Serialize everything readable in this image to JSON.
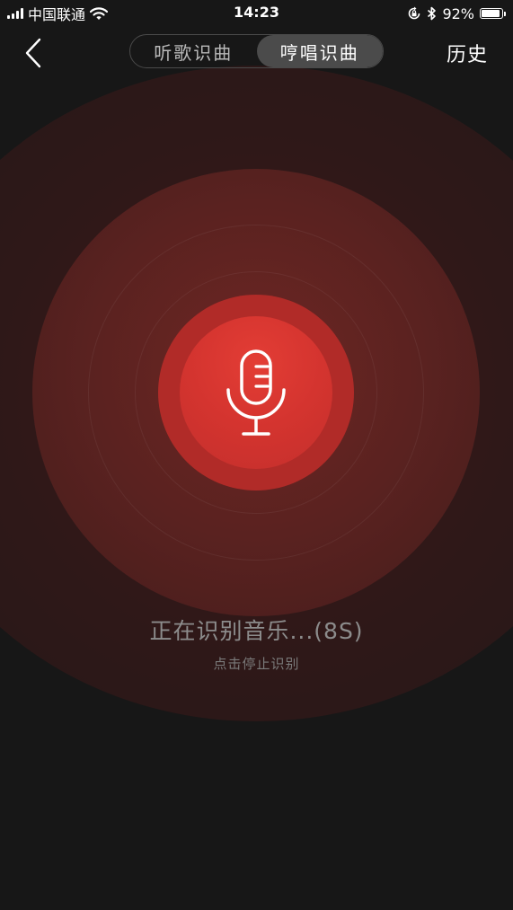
{
  "status_bar": {
    "carrier": "中国联通",
    "time": "14:23",
    "battery_percent": "92%",
    "battery_level": 0.92,
    "icons": [
      "signal-icon",
      "wifi-icon",
      "rotation-lock-icon",
      "bluetooth-icon",
      "battery-icon"
    ]
  },
  "nav": {
    "back_icon": "chevron-left-icon",
    "tabs": [
      {
        "label": "听歌识曲",
        "active": false
      },
      {
        "label": "哼唱识曲",
        "active": true
      }
    ],
    "history_label": "历史"
  },
  "main": {
    "mic_icon": "microphone-icon",
    "status_text": "正在识别音乐...(8S)",
    "hint_text": "点击停止识别"
  },
  "colors": {
    "background": "#171717",
    "accent_red": "#d4342f",
    "segment_active": "#4b4b4b"
  }
}
